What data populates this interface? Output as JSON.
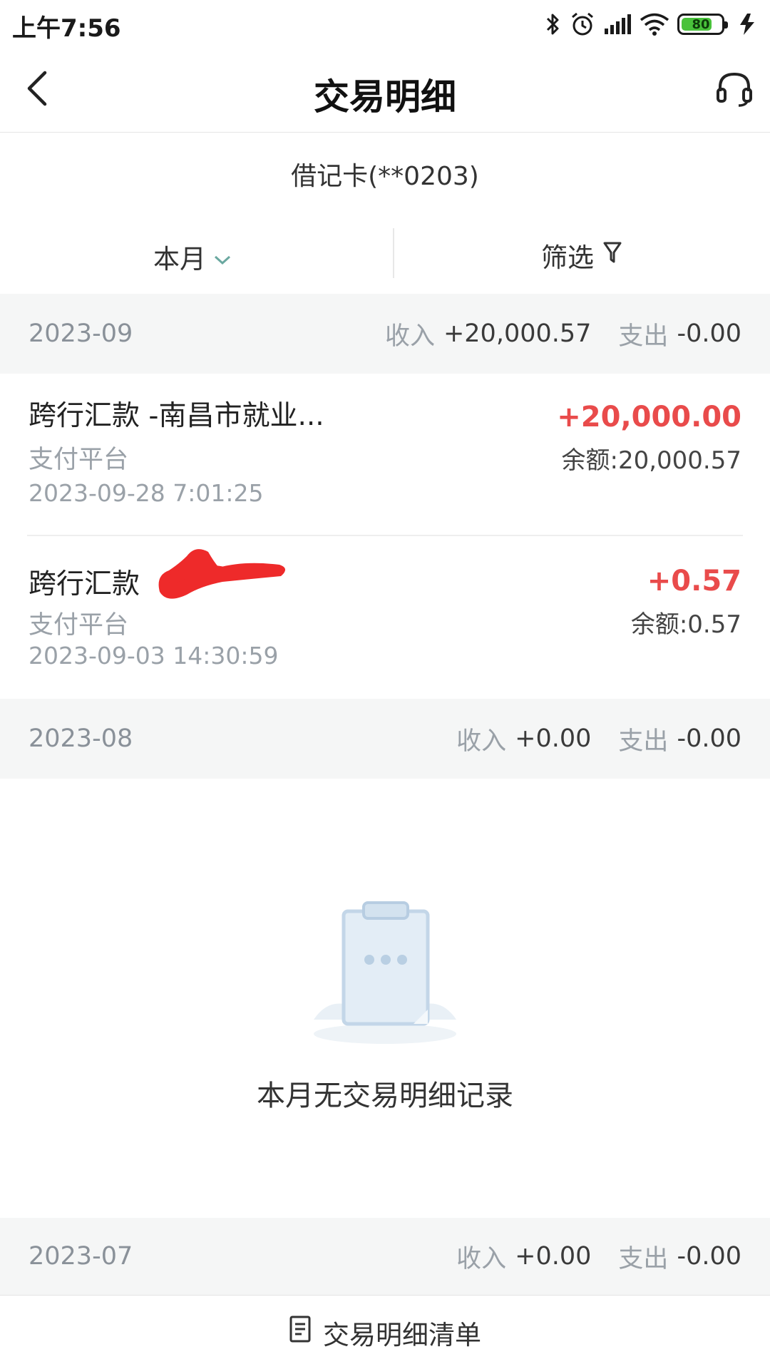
{
  "status_bar": {
    "time": "上午7:56",
    "battery_level": "80",
    "battery_percent": 0.8,
    "icons": [
      "bluetooth-icon",
      "alarm-icon",
      "signal-icon",
      "wifi-icon",
      "battery-icon",
      "charging-icon"
    ]
  },
  "nav": {
    "title": "交易明细",
    "back_icon": "chevron-left-icon",
    "service_icon": "headset-icon"
  },
  "card": {
    "name": "借记卡(**0203)"
  },
  "filters": {
    "month_label": "本月",
    "filter_label": "筛选"
  },
  "months": [
    {
      "month": "2023-09",
      "income_label": "收入",
      "income_value": "+20,000.57",
      "expense_label": "支出",
      "expense_value": "-0.00",
      "transactions": [
        {
          "title": "跨行汇款 -南昌市就业...",
          "channel": "支付平台",
          "datetime": "2023-09-28 7:01:25",
          "amount": "+20,000.00",
          "balance": "余额:20,000.57"
        },
        {
          "title": "跨行汇款",
          "channel": "支付平台",
          "datetime": "2023-09-03 14:30:59",
          "amount": "+0.57",
          "balance": "余额:0.57"
        }
      ]
    },
    {
      "month": "2023-08",
      "income_label": "收入",
      "income_value": "+0.00",
      "expense_label": "支出",
      "expense_value": "-0.00",
      "empty_text": "本月无交易明细记录"
    },
    {
      "month": "2023-07",
      "income_label": "收入",
      "income_value": "+0.00",
      "expense_label": "支出",
      "expense_value": "-0.00"
    }
  ],
  "bottom": {
    "label": "交易明细清单",
    "icon": "document-list-icon"
  },
  "colors": {
    "income_amount": "#e94b4b",
    "month_header_bg": "#f5f6f6",
    "muted_text": "#9aa1a8",
    "redaction": "#ee2a2a"
  }
}
